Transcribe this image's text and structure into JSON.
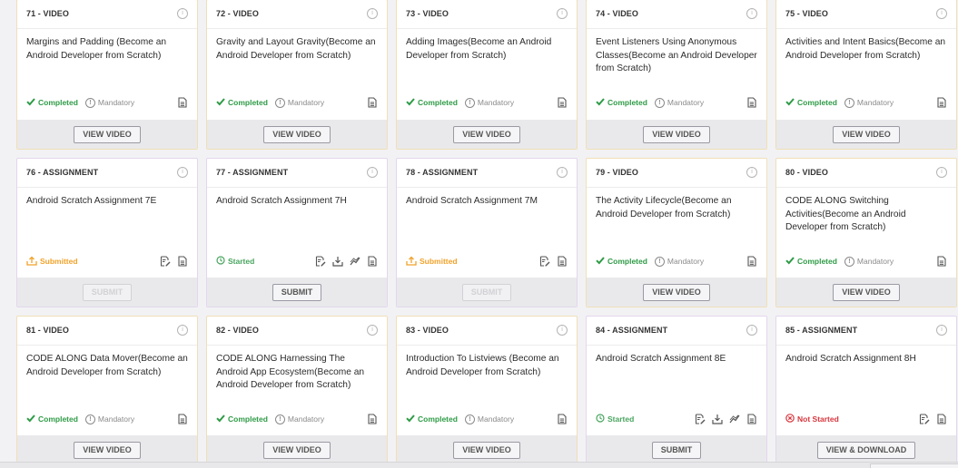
{
  "cards": [
    {
      "type": "71 - VIDEO",
      "kind": "video",
      "title": "Margins and Padding (Become an Android Developer from Scratch)",
      "status": "Completed",
      "status_kind": "completed",
      "mandatory": "Mandatory",
      "button": "VIEW VIDEO",
      "button_disabled": false,
      "actions": [
        "document-icon"
      ]
    },
    {
      "type": "72 - VIDEO",
      "kind": "video",
      "title": "Gravity and Layout Gravity(Become an Android Developer from Scratch)",
      "status": "Completed",
      "status_kind": "completed",
      "mandatory": "Mandatory",
      "button": "VIEW VIDEO",
      "button_disabled": false,
      "actions": [
        "document-icon"
      ]
    },
    {
      "type": "73 - VIDEO",
      "kind": "video",
      "title": "Adding Images(Become an Android Developer from Scratch)",
      "status": "Completed",
      "status_kind": "completed",
      "mandatory": "Mandatory",
      "button": "VIEW VIDEO",
      "button_disabled": false,
      "actions": [
        "document-icon"
      ]
    },
    {
      "type": "74 - VIDEO",
      "kind": "video",
      "title": "Event Listeners Using Anonymous Classes(Become an Android Developer from Scratch)",
      "status": "Completed",
      "status_kind": "completed",
      "mandatory": "Mandatory",
      "button": "VIEW VIDEO",
      "button_disabled": false,
      "actions": [
        "document-icon"
      ]
    },
    {
      "type": "75 - VIDEO",
      "kind": "video",
      "title": "Activities and Intent Basics(Become an Android Developer from Scratch)",
      "status": "Completed",
      "status_kind": "completed",
      "mandatory": "Mandatory",
      "button": "VIEW VIDEO",
      "button_disabled": false,
      "actions": [
        "document-icon"
      ]
    },
    {
      "type": "76 - ASSIGNMENT",
      "kind": "assignment",
      "title": "Android Scratch Assignment 7E",
      "status": "Submitted",
      "status_kind": "submitted",
      "mandatory": "",
      "button": "SUBMIT",
      "button_disabled": true,
      "actions": [
        "edit-document-icon",
        "document-icon"
      ]
    },
    {
      "type": "77 - ASSIGNMENT",
      "kind": "assignment",
      "title": "Android Scratch Assignment 7H",
      "status": "Started",
      "status_kind": "started",
      "mandatory": "",
      "button": "SUBMIT",
      "button_disabled": false,
      "actions": [
        "edit-document-icon",
        "download-icon",
        "chart-icon",
        "document-icon"
      ]
    },
    {
      "type": "78 - ASSIGNMENT",
      "kind": "assignment",
      "title": "Android Scratch Assignment 7M",
      "status": "Submitted",
      "status_kind": "submitted",
      "mandatory": "",
      "button": "SUBMIT",
      "button_disabled": true,
      "actions": [
        "edit-document-icon",
        "document-icon"
      ]
    },
    {
      "type": "79 - VIDEO",
      "kind": "video",
      "title": "The Activity Lifecycle(Become an Android Developer from Scratch)",
      "status": "Completed",
      "status_kind": "completed",
      "mandatory": "Mandatory",
      "button": "VIEW VIDEO",
      "button_disabled": false,
      "actions": [
        "document-icon"
      ]
    },
    {
      "type": "80 - VIDEO",
      "kind": "video",
      "title": "CODE ALONG Switching Activities(Become an Android Developer from Scratch)",
      "status": "Completed",
      "status_kind": "completed",
      "mandatory": "Mandatory",
      "button": "VIEW VIDEO",
      "button_disabled": false,
      "actions": [
        "document-icon"
      ]
    },
    {
      "type": "81 - VIDEO",
      "kind": "video",
      "title": "CODE ALONG Data Mover(Become an Android Developer from Scratch)",
      "status": "Completed",
      "status_kind": "completed",
      "mandatory": "Mandatory",
      "button": "VIEW VIDEO",
      "button_disabled": false,
      "actions": [
        "document-icon"
      ]
    },
    {
      "type": "82 - VIDEO",
      "kind": "video",
      "title": "CODE ALONG Harnessing The Android App Ecosystem(Become an Android Developer from Scratch)",
      "status": "Completed",
      "status_kind": "completed",
      "mandatory": "Mandatory",
      "button": "VIEW VIDEO",
      "button_disabled": false,
      "actions": [
        "document-icon"
      ]
    },
    {
      "type": "83 - VIDEO",
      "kind": "video",
      "title": "Introduction To Listviews (Become an Android Developer from Scratch)",
      "status": "Completed",
      "status_kind": "completed",
      "mandatory": "Mandatory",
      "button": "VIEW VIDEO",
      "button_disabled": false,
      "actions": [
        "document-icon"
      ]
    },
    {
      "type": "84 - ASSIGNMENT",
      "kind": "assignment",
      "title": "Android Scratch Assignment 8E",
      "status": "Started",
      "status_kind": "started",
      "mandatory": "",
      "button": "SUBMIT",
      "button_disabled": false,
      "actions": [
        "edit-document-icon",
        "download-icon",
        "chart-icon",
        "document-icon"
      ]
    },
    {
      "type": "85 - ASSIGNMENT",
      "kind": "assignment",
      "title": "Android Scratch Assignment 8H",
      "status": "Not Started",
      "status_kind": "notstarted",
      "mandatory": "",
      "button": "VIEW & DOWNLOAD",
      "button_disabled": false,
      "actions": [
        "edit-document-icon",
        "document-icon"
      ]
    }
  ],
  "colors": {
    "completed": "#2e9b46",
    "submitted": "#f0a229",
    "started": "#49a55f",
    "not_started": "#d9363e",
    "muted": "#8a8a8a"
  }
}
